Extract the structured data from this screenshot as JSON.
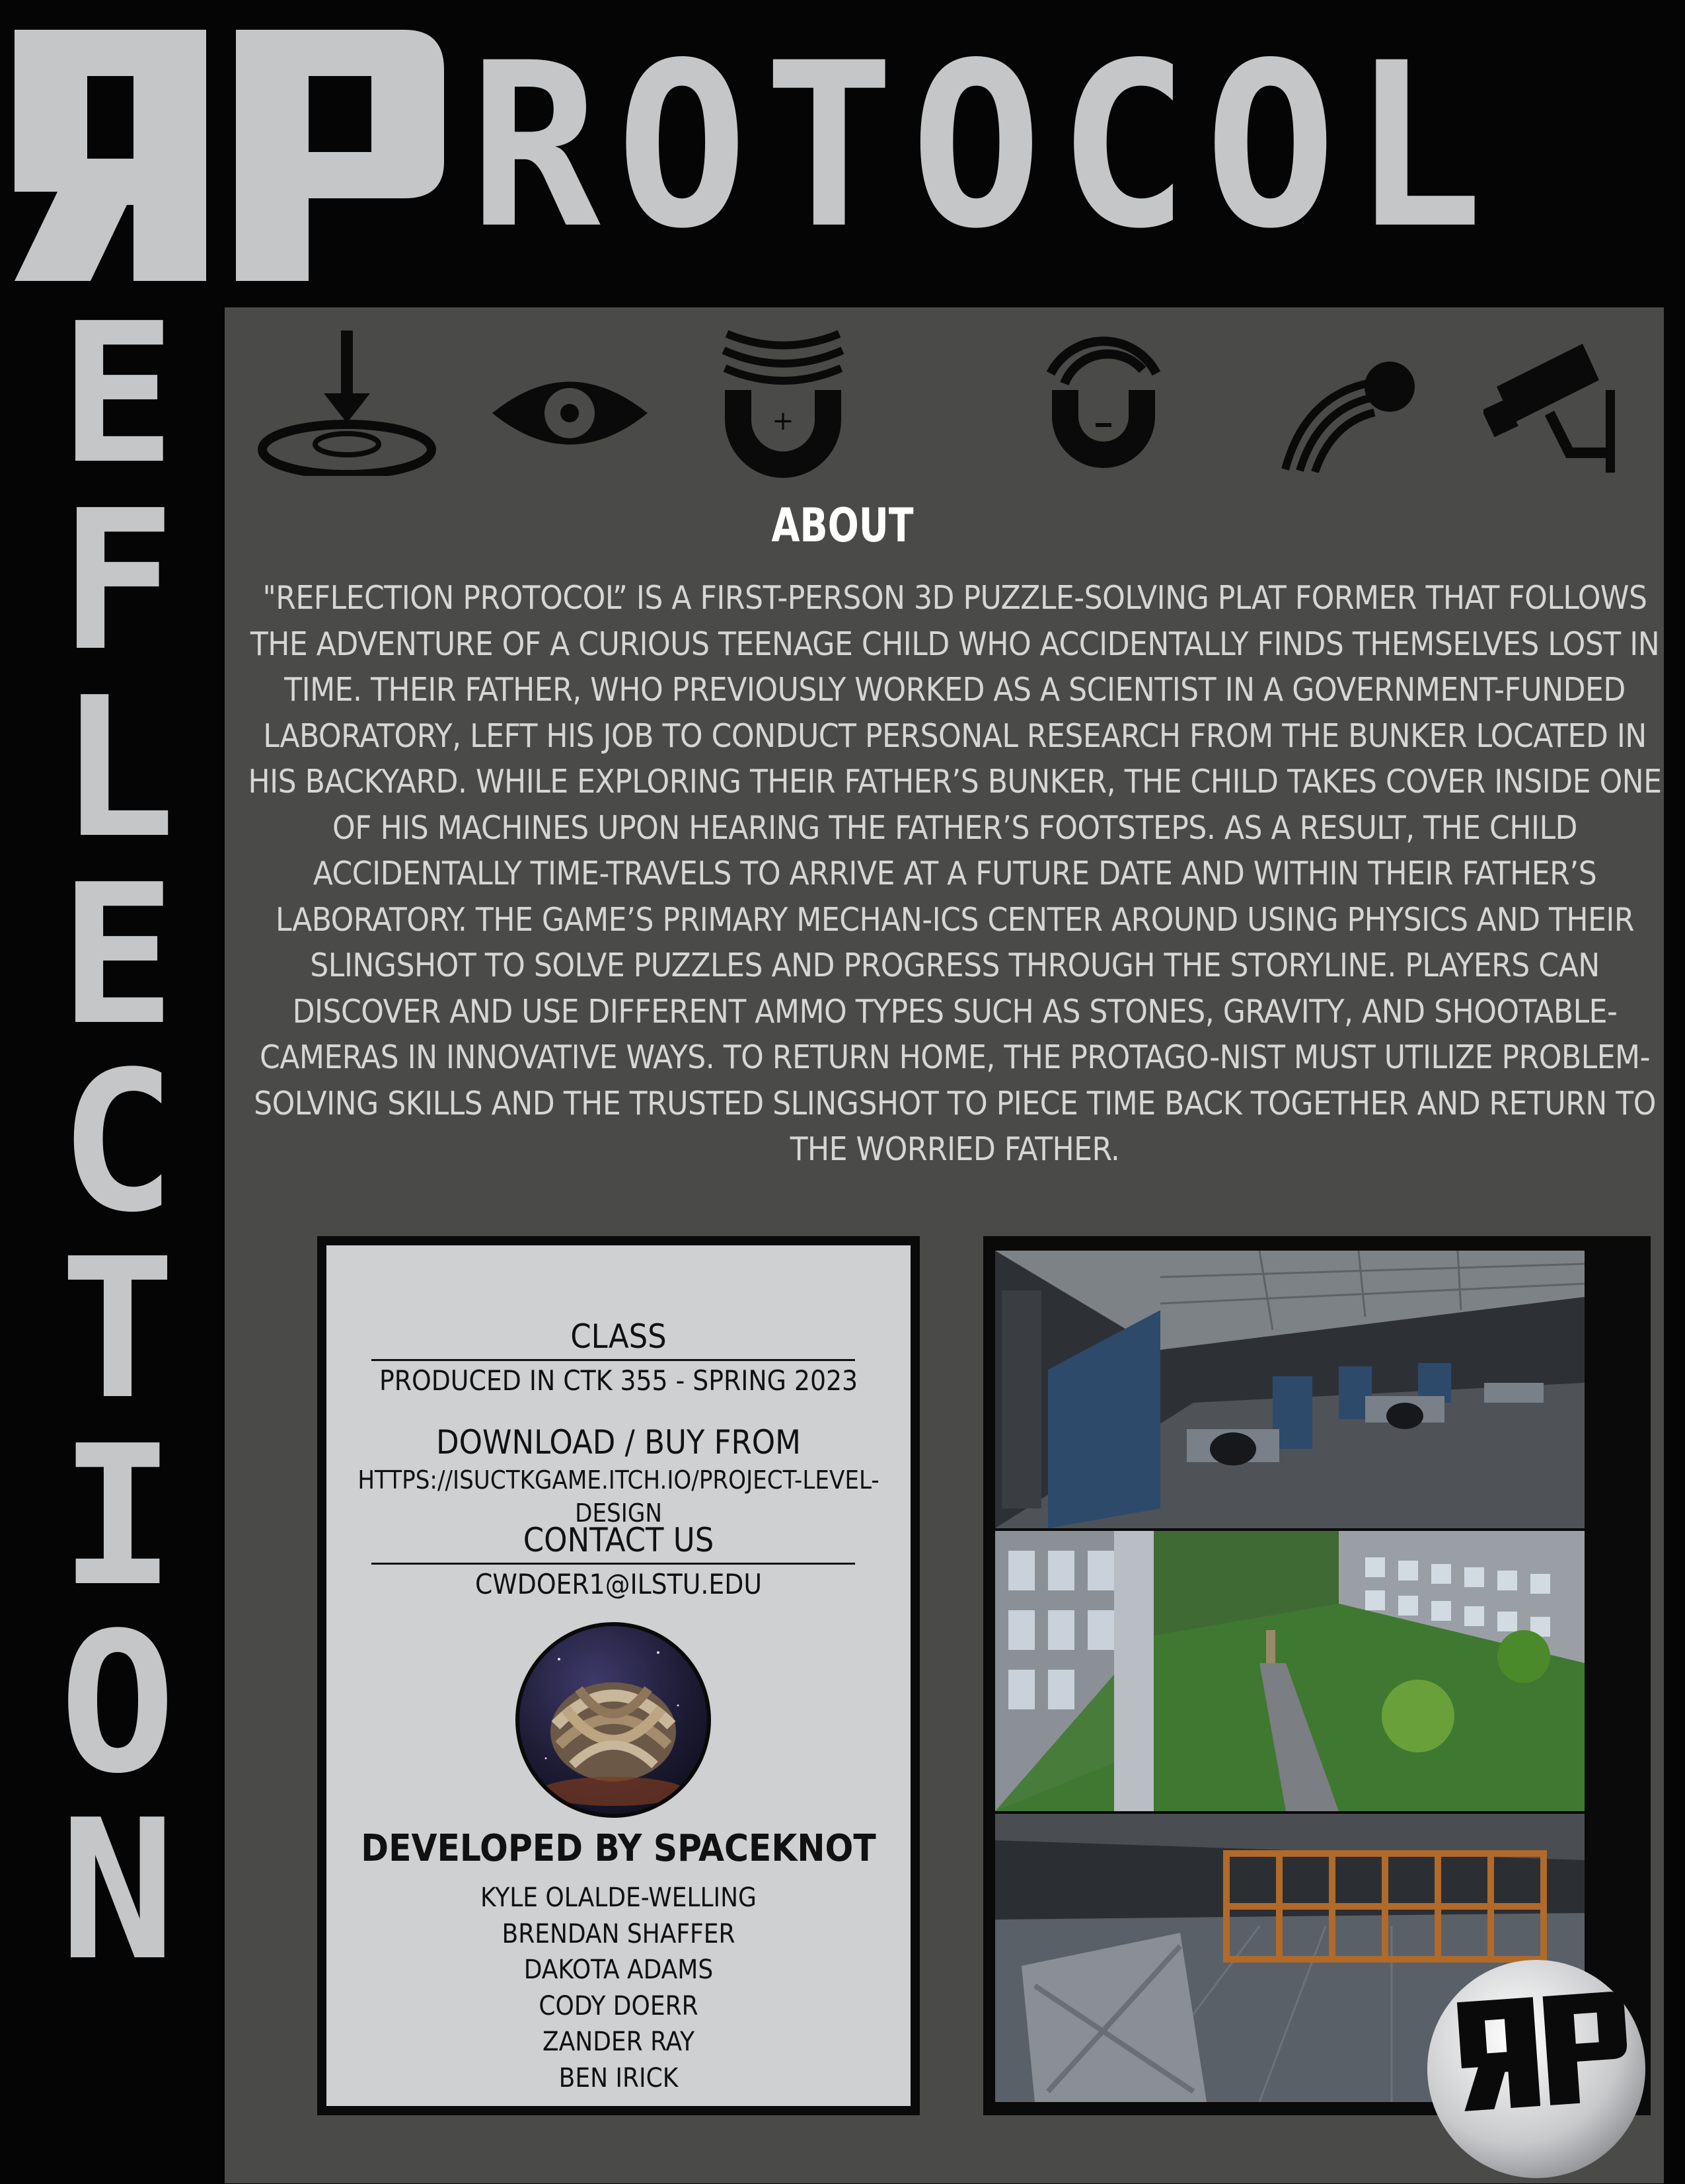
{
  "title": {
    "logo_text": "RP",
    "horizontal_word": "ROTOCOL",
    "vertical_letters": [
      "E",
      "F",
      "L",
      "E",
      "C",
      "T",
      "I",
      "O",
      "N"
    ]
  },
  "icons": [
    "ground-pound-icon",
    "eye-icon",
    "magnet-positive-icon",
    "magnet-negative-icon",
    "projectile-icon",
    "security-camera-icon"
  ],
  "about": {
    "heading": "ABOUT",
    "body": "\"Reflection Protocol” is a first-person 3D puzzle-solving plat former that follows the adventure of a curious teenage child who  accidentally finds themselves lost in time. Their father, who  previously worked as a scientist in a government-funded laboratory, left his job to conduct personal research from the bunker located in his backyard. While exploring their father’s bunker, the child takes cover inside one of his machines upon hearing the father’s footsteps. As a result, the child accidentally time-travels to arrive at a future date and within their father’s laboratory. The game’s primary mechan-ics center around using physics and their slingshot to solve puzzles and progress through the storyline. Players can discover and use different ammo types such as stones, gravity, and shootable-cameras in innovative ways. To return home, the protago-nist must utilize problem-solving skills and the trusted slingshot to piece time back together and return to the worried father."
  },
  "info": {
    "class_heading": "CLASS",
    "class_value": "PRODUCED IN CTK 355 - SPRING 2023",
    "download_heading": "DOWNLOAD / BUY FROM",
    "download_value": "HTTPS://ISUCTKGAME.ITCH.IO/PROJECT-LEVEL-DESIGN",
    "contact_heading": "CONTACT US",
    "contact_value": "CWDOER1@ILSTU.EDU",
    "developed_heading": "DEVELOPED BY SPACEKNOT",
    "developers": [
      "KYLE OLALDE-WELLING",
      "BRENDAN SHAFFER",
      "DAKOTA ADAMS",
      "CODY DOERR",
      "ZANDER RAY",
      "BEN IRICK"
    ]
  },
  "colors": {
    "background": "#050505",
    "panel": "#4a4a49",
    "title_gray": "#c5c6c8",
    "info_box": "#cfd0d2"
  }
}
